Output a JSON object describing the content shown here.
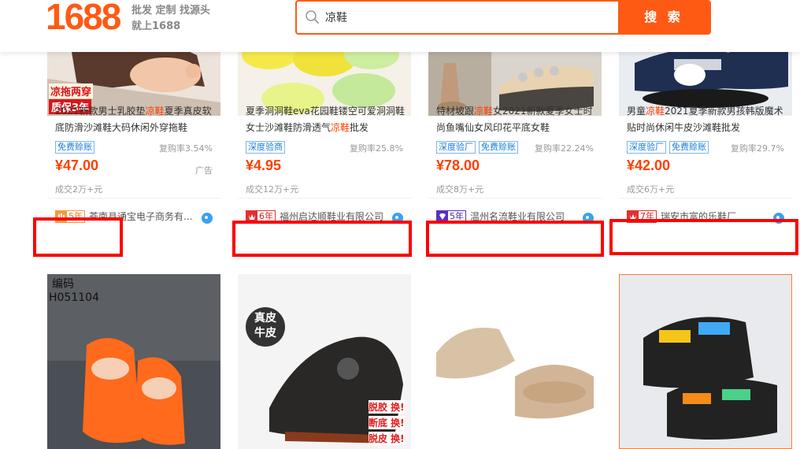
{
  "header": {
    "logo": "1688",
    "slogan_line1": "批发 定制 找源头",
    "slogan_line2": "就上1688",
    "search_value": "凉鞋",
    "search_button": "搜 索"
  },
  "products": [
    {
      "image_overlay_1": "凉拖两穿",
      "image_overlay_2": "质保3年",
      "title_pre": "2021新款男士乳胶垫",
      "title_hl": "凉鞋",
      "title_post": "夏季真皮软底防滑沙滩鞋大码休闲外穿拖鞋",
      "tags": [
        "免费赊账"
      ],
      "repeat_rate": "复购率3.54%",
      "price": "¥47.00",
      "ad_label": "广告",
      "deal": "成交2万+元",
      "shop_years": "5年",
      "shop_name": "苍南县通宝电子商务有..."
    },
    {
      "title_pre": "夏季洞洞鞋eva花园鞋镂空可爱洞洞鞋女士沙滩鞋防滑透气",
      "title_hl": "凉鞋",
      "title_post": "批发",
      "tags": [
        "深度验商"
      ],
      "repeat_rate": "复购率25.8%",
      "price": "¥4.95",
      "deal": "成交12万+元",
      "shop_years": "6年",
      "shop_name": "福州启达顺鞋业有限公司"
    },
    {
      "title_pre": "特材坡跟",
      "title_hl": "凉鞋",
      "title_post": "女2021新款夏季女士时尚鱼嘴仙女风印花平底女鞋",
      "tags": [
        "深度验厂",
        "免费赊账"
      ],
      "repeat_rate": "复购率22.24%",
      "price": "¥78.00",
      "deal": "成交8万+元",
      "shop_years": "5年",
      "shop_name": "温州名流鞋业有限公司"
    },
    {
      "title_pre": "男童",
      "title_hl": "凉鞋",
      "title_post": "2021夏季新款男孩韩版魔术贴时尚休闲牛皮沙滩鞋批发",
      "tags": [
        "深度验厂",
        "免费赊账"
      ],
      "repeat_rate": "复购率29.7%",
      "price": "¥42.00",
      "deal": "成交6万+元",
      "shop_years": "7年",
      "shop_name": "瑞安市富的乐鞋厂"
    }
  ],
  "bottom_products": [
    {
      "image_overlay_1": "编码",
      "image_overlay_2": "H051104"
    },
    {
      "image_overlay_1": "真皮",
      "image_overlay_2": "牛皮",
      "image_overlay_3": "脱胶 换!",
      "image_overlay_4": "断底 换!",
      "image_overlay_5": "脱皮 换!"
    },
    {},
    {}
  ],
  "colors": {
    "brand": "#ff5a14",
    "price": "#ff4000",
    "highlight_box": "#ff0000",
    "tag_blue": "#1a7dd6"
  }
}
